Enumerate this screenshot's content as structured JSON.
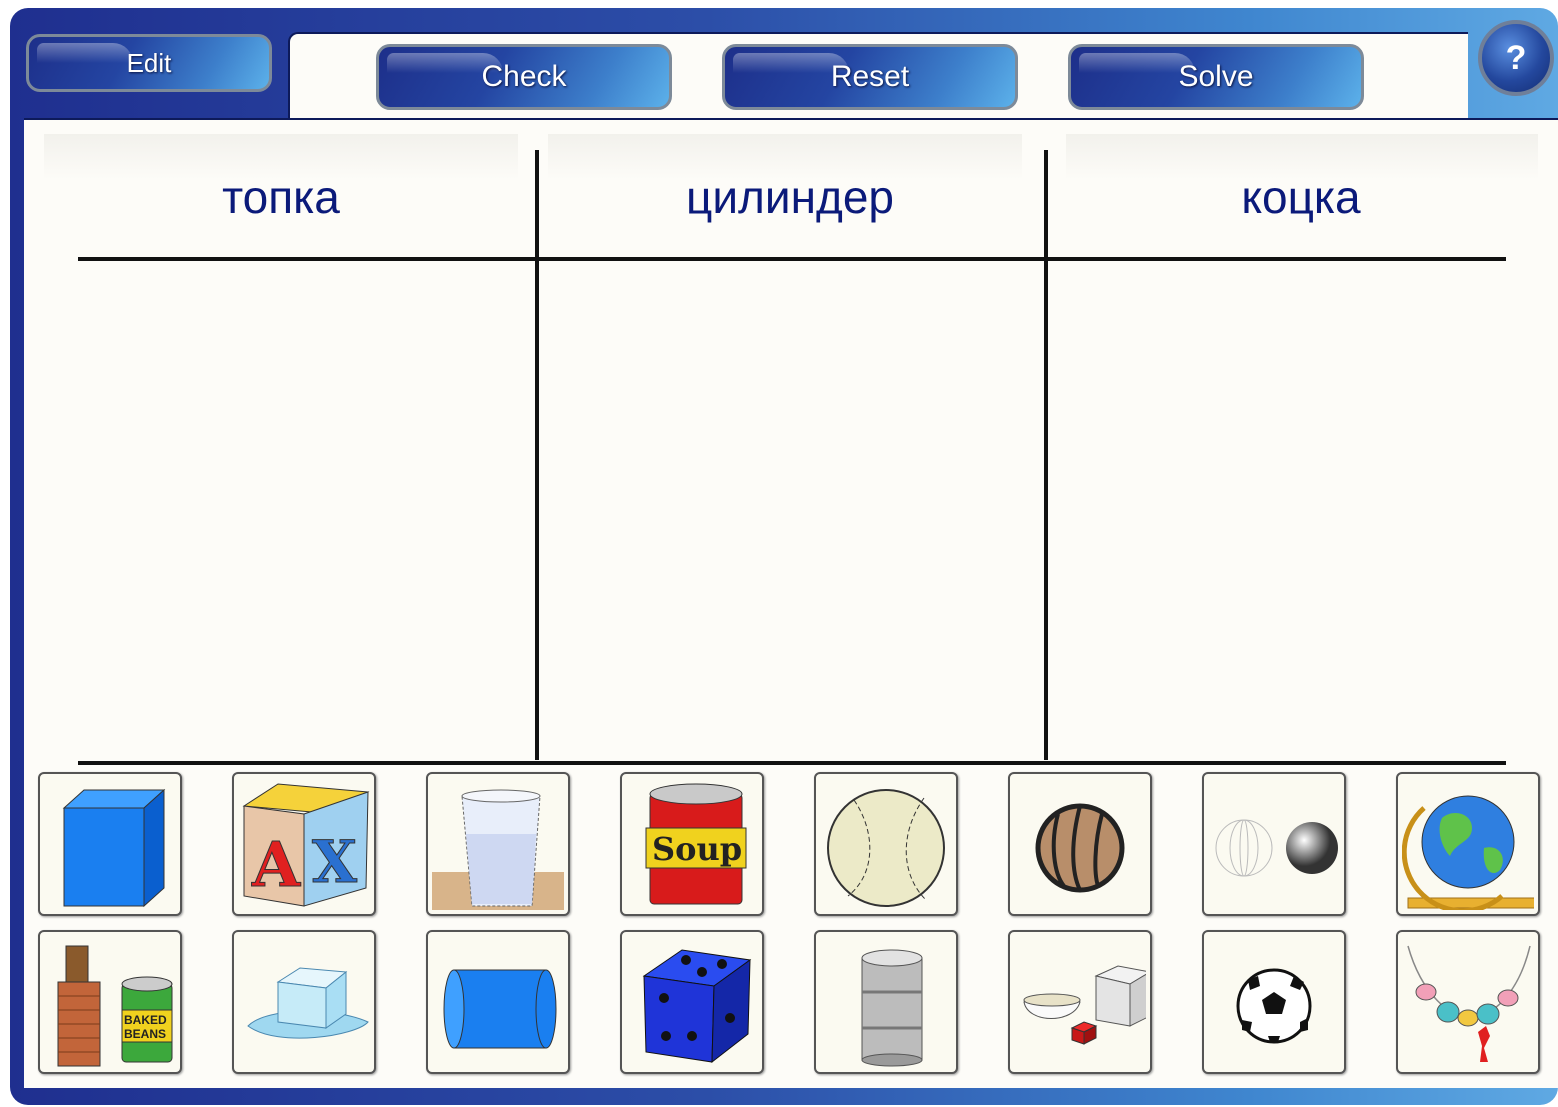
{
  "toolbar": {
    "edit_label": "Edit",
    "check_label": "Check",
    "reset_label": "Reset",
    "solve_label": "Solve",
    "help_label": "?"
  },
  "columns": [
    {
      "title": "топка"
    },
    {
      "title": "цилиндер"
    },
    {
      "title": "коцка"
    }
  ],
  "cards": {
    "row1": [
      "blue-cube-icon",
      "alphabet-block-icon",
      "water-glass-icon",
      "soup-can-icon",
      "baseball-icon",
      "volleyball-icon",
      "spheres-icon",
      "globe-icon"
    ],
    "row2": [
      "chimney-and-beans-can-icon",
      "ice-cube-icon",
      "blue-cylinder-icon",
      "blue-die-icon",
      "metal-barrel-icon",
      "box-and-bowl-icon",
      "soccer-ball-icon",
      "bead-necklace-icon"
    ],
    "texts": {
      "soup": "Soup",
      "beans_line1": "BAKED",
      "beans_line2": "BEANS",
      "block_letter1": "A",
      "block_letter2": "X"
    }
  },
  "colors": {
    "accent": "#0b1a7a",
    "button": "#2445a2"
  }
}
